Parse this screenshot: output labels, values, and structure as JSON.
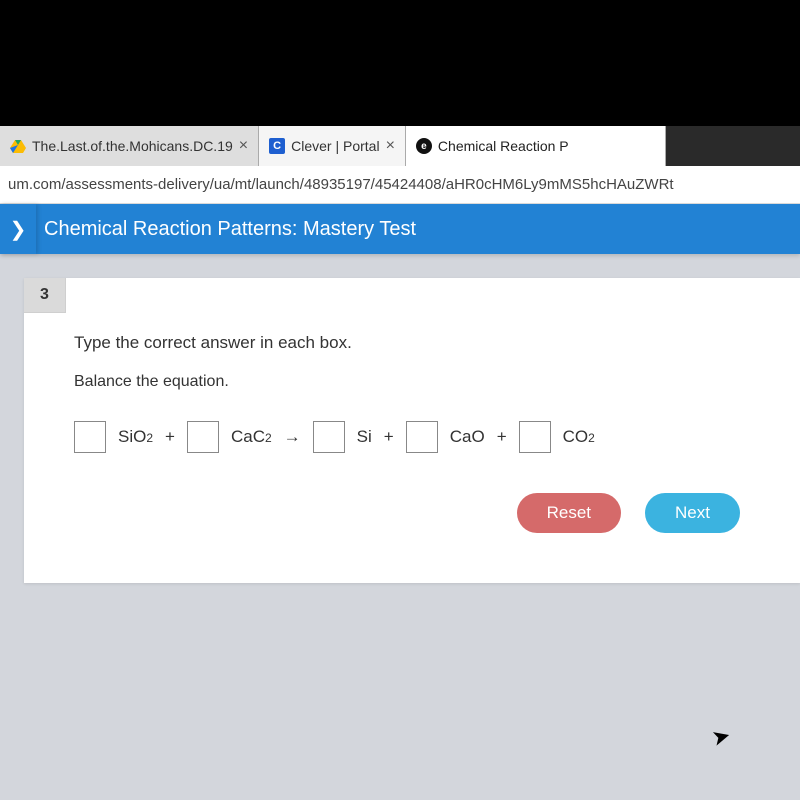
{
  "tabs": [
    {
      "title": "The.Last.of.the.Mohicans.DC.19"
    },
    {
      "icon_letter": "C",
      "title": "Clever | Portal"
    },
    {
      "icon_letter": "e",
      "title": "Chemical Reaction P"
    }
  ],
  "url": "um.com/assessments-delivery/ua/mt/launch/48935197/45424408/aHR0cHM6Ly9mMS5hcHAuZWRt",
  "header": {
    "title": "Chemical Reaction Patterns: Mastery Test",
    "back_icon": "❯"
  },
  "question": {
    "number": "3",
    "instruction": "Type the correct answer in each box.",
    "subtext": "Balance the equation.",
    "equation": {
      "lhs": [
        {
          "formula": "SiO",
          "sub": "2"
        },
        {
          "formula": "CaC",
          "sub": "2"
        }
      ],
      "rhs": [
        {
          "formula": "Si",
          "sub": ""
        },
        {
          "formula": "CaO",
          "sub": ""
        },
        {
          "formula": "CO",
          "sub": "2"
        }
      ],
      "plus": "+",
      "arrow": "→"
    }
  },
  "buttons": {
    "reset": "Reset",
    "next": "Next"
  }
}
